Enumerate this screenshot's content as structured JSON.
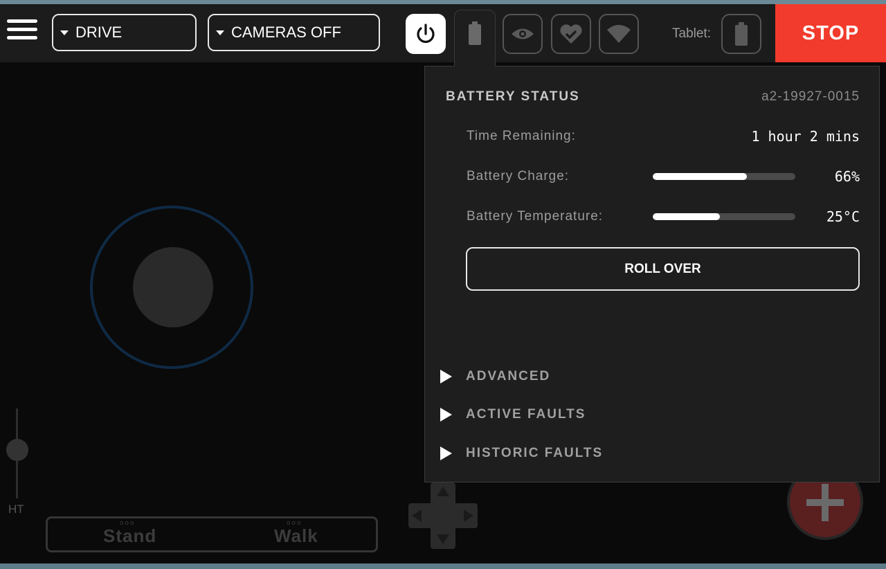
{
  "header": {
    "mode_dropdown": "DRIVE",
    "camera_dropdown": "CAMERAS OFF",
    "status_icons": [
      "power-icon",
      "battery-icon",
      "eye-icon",
      "heart-check-icon",
      "wifi-icon"
    ],
    "tablet_label": "Tablet:",
    "stop_label": "STOP"
  },
  "colors": {
    "stop": "#f23b2c",
    "panel_bg": "#1e1e1e",
    "topbar": "#1c1c1c"
  },
  "battery_panel": {
    "title": "BATTERY STATUS",
    "serial": "a2-19927-0015",
    "time_remaining_label": "Time Remaining:",
    "time_remaining_value": "1 hour 2 mins",
    "charge_label": "Battery Charge:",
    "charge_value": "66%",
    "charge_fraction": 0.66,
    "temp_label": "Battery Temperature:",
    "temp_value": "25°C",
    "temp_fraction": 0.47,
    "roll_over": "ROLL OVER",
    "sections": [
      "ADVANCED",
      "ACTIVE FAULTS",
      "HISTORIC FAULTS"
    ]
  },
  "controls": {
    "height_label": "HT",
    "stand_label": "Stand",
    "walk_label": "Walk",
    "stand_dots": "ooo",
    "walk_dots": "ooo"
  }
}
